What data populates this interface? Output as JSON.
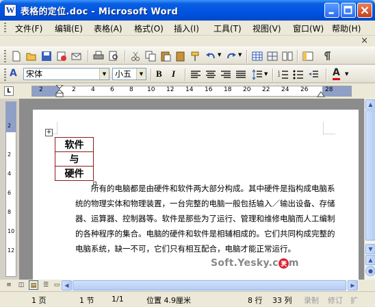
{
  "window": {
    "title": "表格的定位.doc - Microsoft Word",
    "app_icon": "W"
  },
  "menu": [
    "文件(F)",
    "编辑(E)",
    "表格(A)",
    "格式(O)",
    "插入(I)",
    "工具(T)",
    "视图(V)",
    "窗口(W)",
    "帮助(H)"
  ],
  "doc_close": "×",
  "format": {
    "style_indicator": "A",
    "font": "宋体",
    "size": "小五",
    "bold": "B",
    "italic": "I",
    "font_color_label": "A"
  },
  "ruler": {
    "tab_selector": "L",
    "h_numbers": [
      "2",
      "2",
      "4",
      "6",
      "8",
      "10",
      "12",
      "14",
      "16",
      "18",
      "20",
      "22",
      "24",
      "26",
      "28"
    ],
    "v_numbers": [
      "2",
      "2",
      "4",
      "6",
      "8",
      "10",
      "12"
    ]
  },
  "document": {
    "table_cells": [
      "软件",
      "与",
      "硬件"
    ],
    "move_handle": "+",
    "paragraph": "所有的电脑都是由硬件和软件两大部分构成。其中硬件是指构成电脑系统的物理实体和物理装置，一台完整的电脑一般包括输入／输出设备、存储器、运算器、控制器等。软件是那些为了运行、管理和维修电脑而人工编制的各种程序的集合。电脑的硬件和软件是相辅相成的。它们共同构成完整的电脑系统，缺一不可，它们只有相互配合，电脑才能正常运行。"
  },
  "watermark": {
    "text": "Soft.Yesky.c",
    "badge": "天极",
    "tail": "m"
  },
  "status": {
    "page": "1 页",
    "section": "1 节",
    "pages": "1/1",
    "position": "位置 4.9厘米",
    "line": "8 行",
    "column": "33 列",
    "rec": "录制",
    "trk": "修订",
    "ext": "扩"
  }
}
